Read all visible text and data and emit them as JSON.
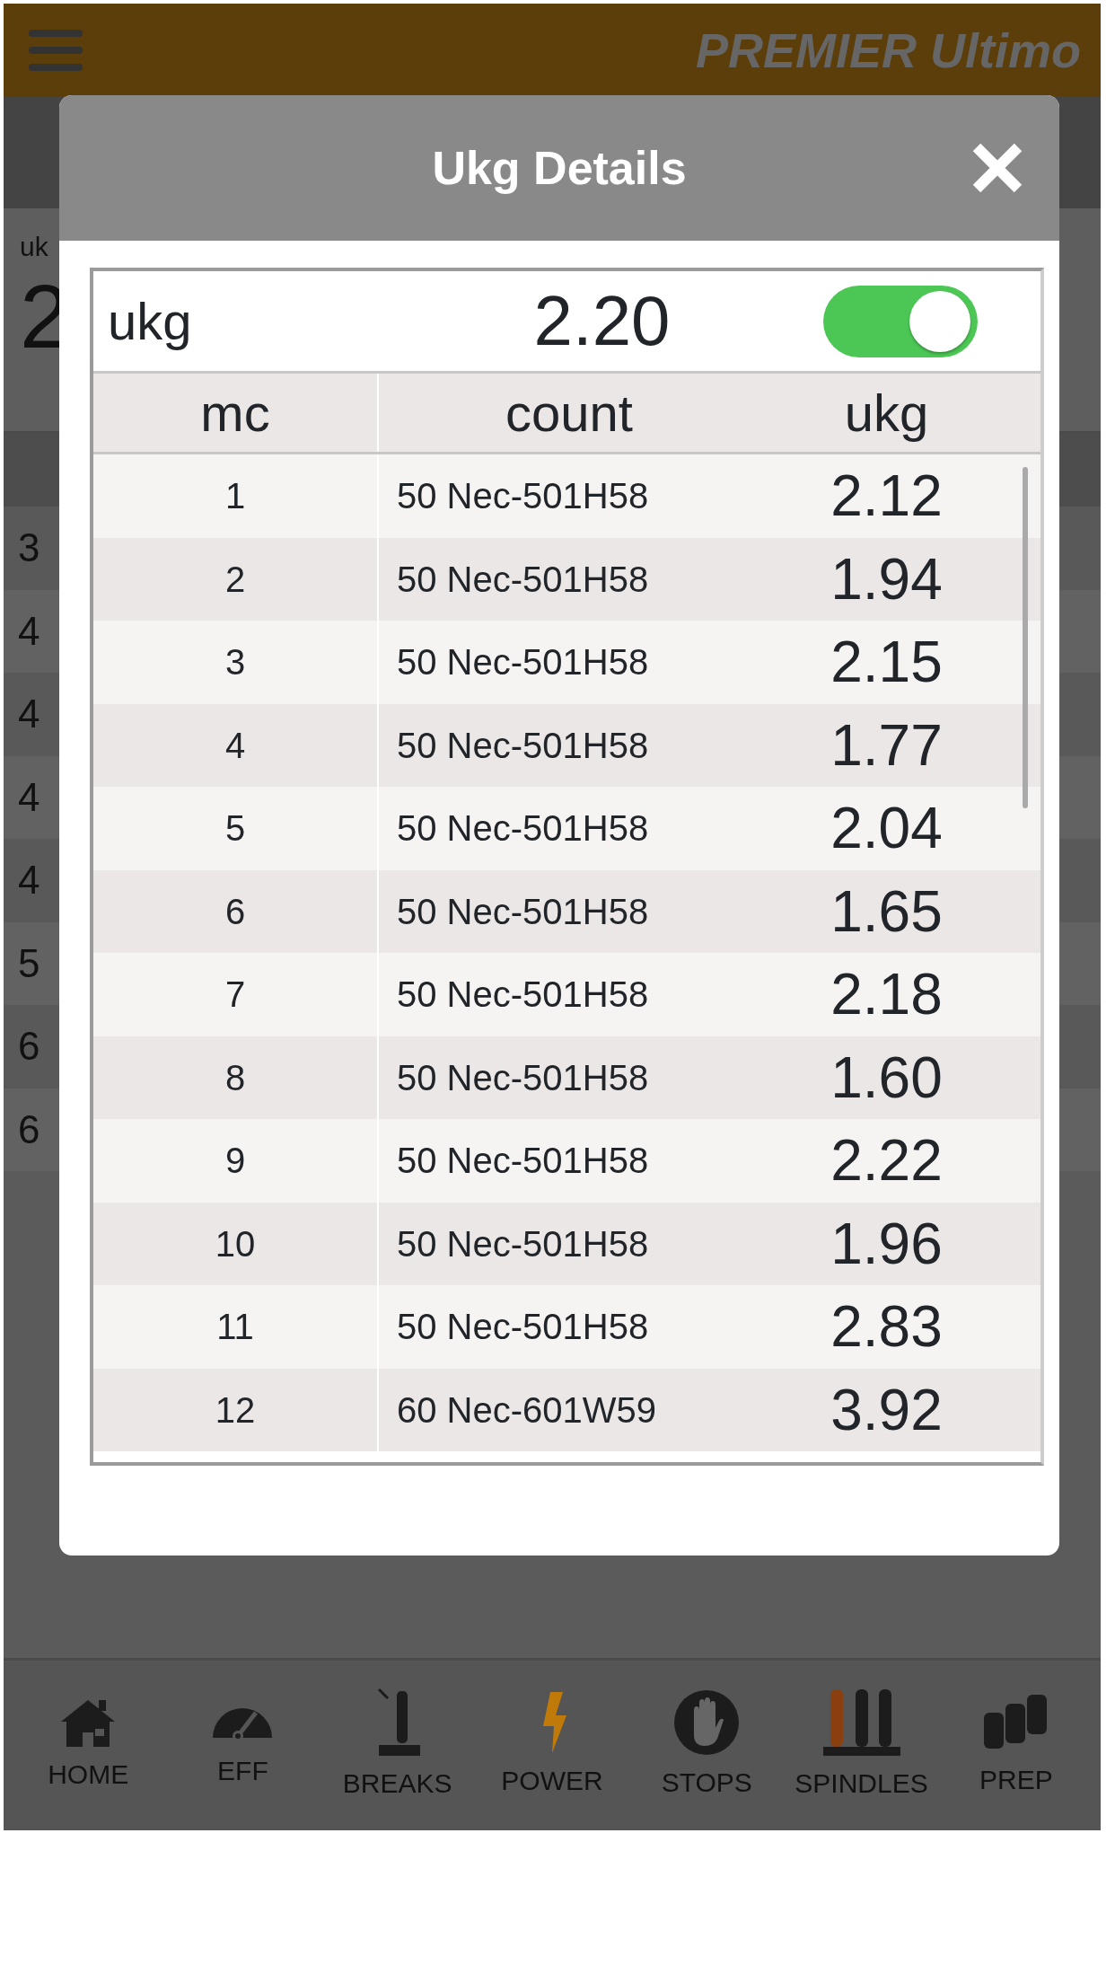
{
  "header": {
    "title": "PREMIER Ultimo"
  },
  "background": {
    "card_label": "uk",
    "card_value": "2",
    "row_labels": [
      "3",
      "4",
      "4",
      "4",
      "4",
      "5",
      "6",
      "6"
    ]
  },
  "modal": {
    "title": "Ukg Details",
    "summary": {
      "label": "ukg",
      "value": "2.20",
      "on": true
    },
    "table": {
      "columns": [
        "mc",
        "count",
        "ukg"
      ],
      "rows": [
        [
          "1",
          "50 Nec-501H58",
          "2.12"
        ],
        [
          "2",
          "50 Nec-501H58",
          "1.94"
        ],
        [
          "3",
          "50 Nec-501H58",
          "2.15"
        ],
        [
          "4",
          "50 Nec-501H58",
          "1.77"
        ],
        [
          "5",
          "50 Nec-501H58",
          "2.04"
        ],
        [
          "6",
          "50 Nec-501H58",
          "1.65"
        ],
        [
          "7",
          "50 Nec-501H58",
          "2.18"
        ],
        [
          "8",
          "50 Nec-501H58",
          "1.60"
        ],
        [
          "9",
          "50 Nec-501H58",
          "2.22"
        ],
        [
          "10",
          "50 Nec-501H58",
          "1.96"
        ],
        [
          "11",
          "50 Nec-501H58",
          "2.83"
        ],
        [
          "12",
          "60 Nec-601W59",
          "3.92"
        ]
      ]
    }
  },
  "nav": [
    {
      "kind": "home",
      "label": "HOME",
      "selected": false
    },
    {
      "kind": "eff",
      "label": "EFF",
      "selected": false
    },
    {
      "kind": "breaks",
      "label": "BREAKS",
      "selected": false
    },
    {
      "kind": "power",
      "label": "POWER",
      "selected": true
    },
    {
      "kind": "stops",
      "label": "STOPS",
      "selected": false
    },
    {
      "kind": "spindles",
      "label": "SPINDLES",
      "selected": false
    },
    {
      "kind": "prep",
      "label": "PREP",
      "selected": false
    }
  ]
}
